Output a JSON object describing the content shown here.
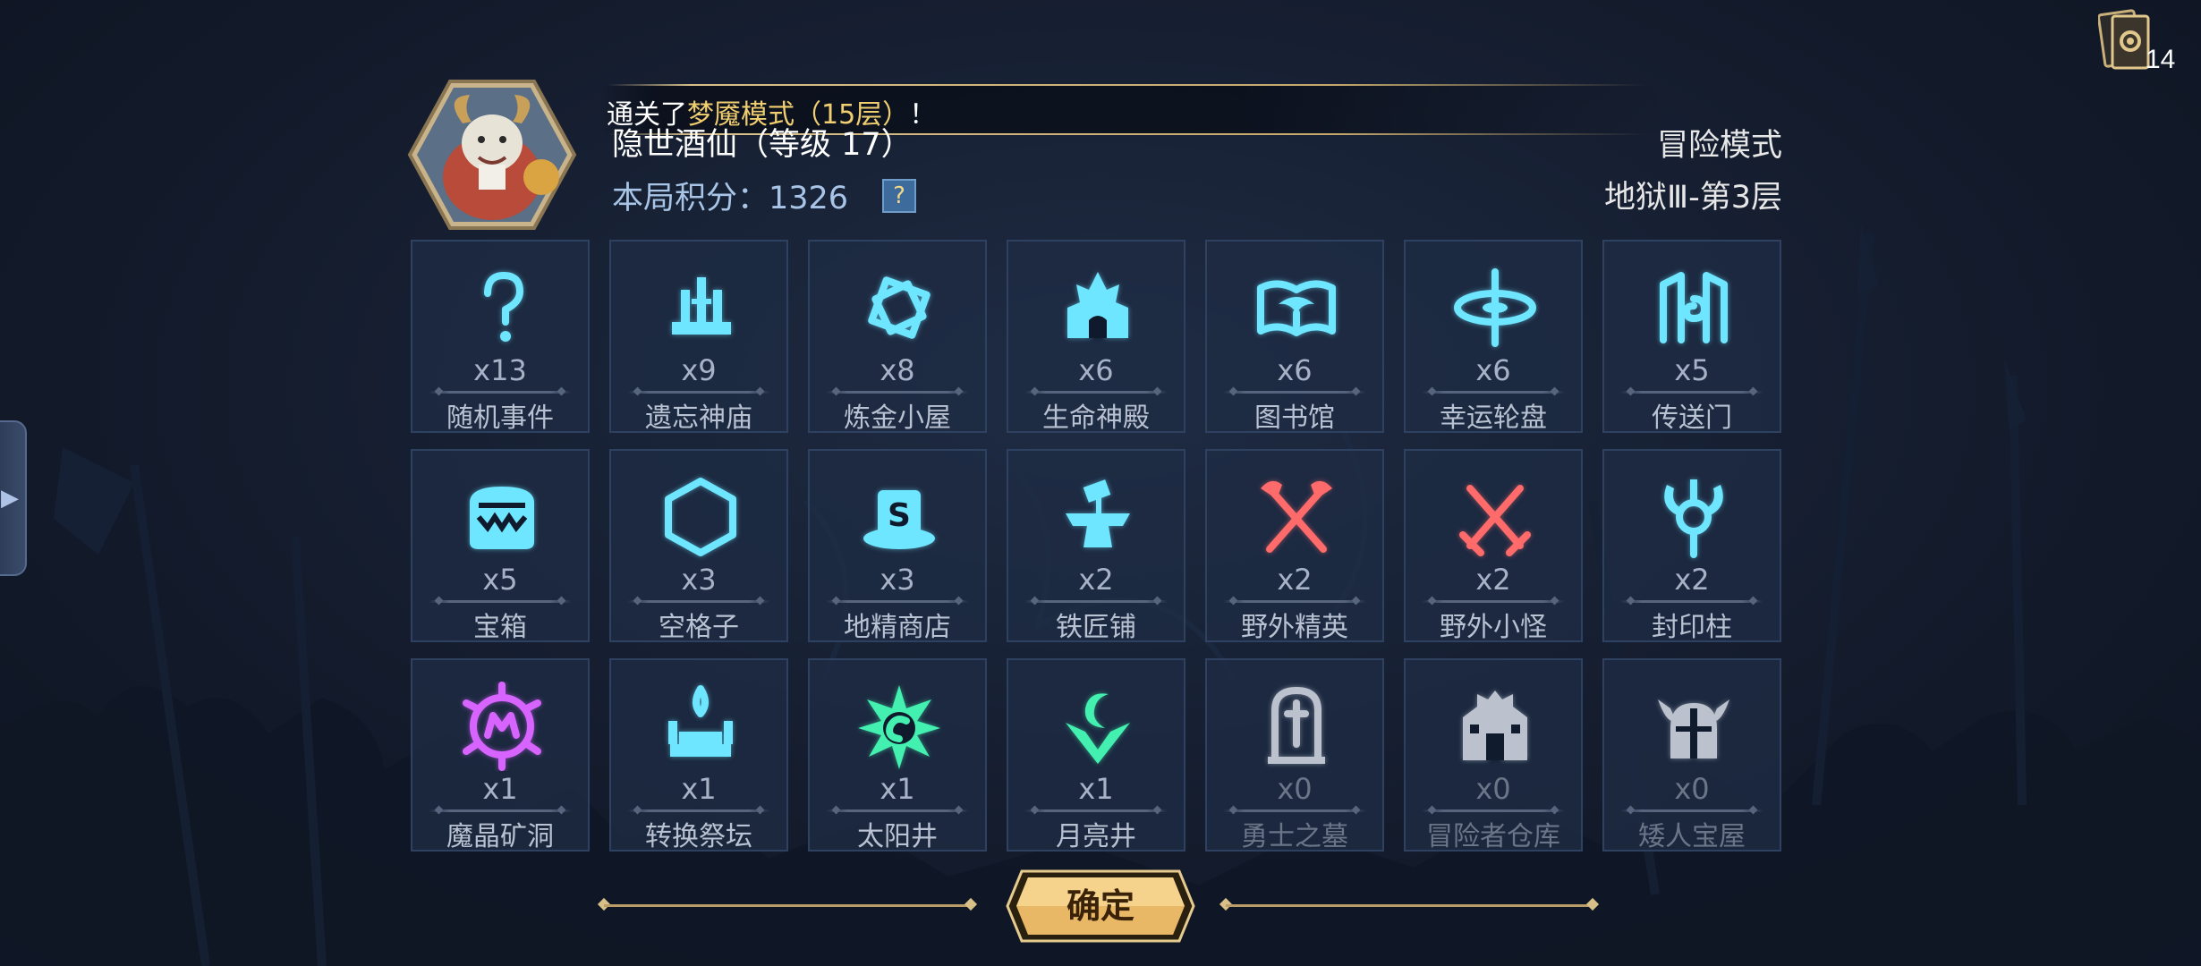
{
  "deck": {
    "count": "14",
    "icon": "card-deck-icon"
  },
  "banner": {
    "prefix": "通关了",
    "highlight": "梦魇模式（15层）",
    "suffix": "！"
  },
  "hero": {
    "name": "隐世酒仙（等级 17）",
    "avatar": "goat-hero-avatar"
  },
  "score": {
    "label": "本局积分：1326",
    "help": "?"
  },
  "mode": {
    "name": "冒险模式",
    "floor": "地狱Ⅲ-第3层"
  },
  "cells": [
    {
      "count": "x13",
      "label": "随机事件",
      "icon": "question-icon",
      "color": "#6fe6ff"
    },
    {
      "count": "x9",
      "label": "遗忘神庙",
      "icon": "temple-icon",
      "color": "#6fe6ff"
    },
    {
      "count": "x8",
      "label": "炼金小屋",
      "icon": "alchemy-icon",
      "color": "#6fe6ff"
    },
    {
      "count": "x6",
      "label": "生命神殿",
      "icon": "life-shrine-icon",
      "color": "#6fe6ff"
    },
    {
      "count": "x6",
      "label": "图书馆",
      "icon": "book-icon",
      "color": "#6fe6ff"
    },
    {
      "count": "x6",
      "label": "幸运轮盘",
      "icon": "wheel-icon",
      "color": "#6fe6ff"
    },
    {
      "count": "x5",
      "label": "传送门",
      "icon": "portal-icon",
      "color": "#6fe6ff"
    },
    {
      "count": "x5",
      "label": "宝箱",
      "icon": "chest-icon",
      "color": "#6fe6ff"
    },
    {
      "count": "x3",
      "label": "空格子",
      "icon": "hexagon-icon",
      "color": "#6fe6ff"
    },
    {
      "count": "x3",
      "label": "地精商店",
      "icon": "goblin-shop-icon",
      "color": "#6fe6ff"
    },
    {
      "count": "x2",
      "label": "铁匠铺",
      "icon": "anvil-icon",
      "color": "#6fe6ff"
    },
    {
      "count": "x2",
      "label": "野外精英",
      "icon": "crossed-axes-icon",
      "color": "#ff6a6a"
    },
    {
      "count": "x2",
      "label": "野外小怪",
      "icon": "crossed-swords-icon",
      "color": "#ff6a6a"
    },
    {
      "count": "x2",
      "label": "封印柱",
      "icon": "horned-seal-icon",
      "color": "#6fe6ff"
    },
    {
      "count": "x1",
      "label": "魔晶矿洞",
      "icon": "crystal-mine-icon",
      "color": "#d864ff"
    },
    {
      "count": "x1",
      "label": "转换祭坛",
      "icon": "altar-icon",
      "color": "#6fe6ff"
    },
    {
      "count": "x1",
      "label": "太阳井",
      "icon": "sun-icon",
      "color": "#43f0b0"
    },
    {
      "count": "x1",
      "label": "月亮井",
      "icon": "moon-icon",
      "color": "#43f0b0"
    },
    {
      "count": "x0",
      "label": "勇士之墓",
      "icon": "tombstone-icon",
      "color": "#d8dde6"
    },
    {
      "count": "x0",
      "label": "冒险者仓库",
      "icon": "warehouse-icon",
      "color": "#d8dde6"
    },
    {
      "count": "x0",
      "label": "矮人宝屋",
      "icon": "dwarf-helmet-icon",
      "color": "#d8dde6"
    }
  ],
  "confirm": {
    "label": "确定"
  },
  "side_tab": {
    "icon": "chevron-right-icon"
  }
}
